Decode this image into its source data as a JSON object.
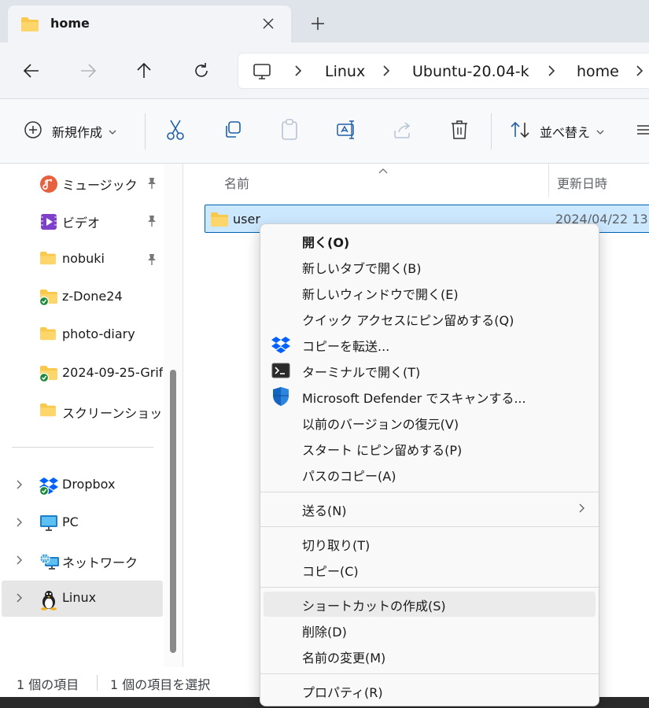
{
  "tab": {
    "title": "home",
    "close": "✕",
    "new": "+"
  },
  "breadcrumb": [
    "Linux",
    "Ubuntu-20.04-k",
    "home"
  ],
  "toolbar": {
    "new_label": "新規作成",
    "sort_label": "並べ替え"
  },
  "sidebar": {
    "quick": [
      {
        "label": "ミュージック",
        "icon": "music-icon",
        "pinned": true
      },
      {
        "label": "ビデオ",
        "icon": "video-icon",
        "pinned": true
      },
      {
        "label": "nobuki",
        "icon": "folder-icon",
        "pinned": true
      },
      {
        "label": "z-Done24",
        "icon": "folder-synced-icon",
        "pinned": false
      },
      {
        "label": "photo-diary",
        "icon": "folder-icon",
        "pinned": false
      },
      {
        "label": "2024-09-25-Grif",
        "icon": "folder-synced-icon",
        "pinned": false
      },
      {
        "label": "スクリーンショット",
        "icon": "folder-icon",
        "pinned": false
      }
    ],
    "locations": [
      {
        "label": "Dropbox",
        "icon": "dropbox-icon"
      },
      {
        "label": "PC",
        "icon": "pc-icon"
      },
      {
        "label": "ネットワーク",
        "icon": "network-icon"
      },
      {
        "label": "Linux",
        "icon": "linux-icon",
        "selected": true
      }
    ]
  },
  "columns": {
    "name": "名前",
    "date": "更新日時"
  },
  "files": [
    {
      "name": "user",
      "date": "2024/04/22 13"
    }
  ],
  "status": {
    "count": "1 個の項目",
    "selected": "1 個の項目を選択"
  },
  "context_menu": {
    "groups": [
      [
        {
          "label": "開く(O)",
          "bold": true,
          "icon": ""
        },
        {
          "label": "新しいタブで開く(B)",
          "icon": ""
        },
        {
          "label": "新しいウィンドウで開く(E)",
          "icon": ""
        },
        {
          "label": "クイック アクセスにピン留めする(Q)",
          "icon": ""
        },
        {
          "label": "コピーを転送...",
          "icon": "dropbox-icon"
        },
        {
          "label": "ターミナルで開く(T)",
          "icon": "terminal-icon"
        },
        {
          "label": "Microsoft Defender でスキャンする...",
          "icon": "defender-shield-icon"
        },
        {
          "label": "以前のバージョンの復元(V)",
          "icon": ""
        },
        {
          "label": "スタート にピン留めする(P)",
          "icon": ""
        },
        {
          "label": "パスのコピー(A)",
          "icon": ""
        }
      ],
      [
        {
          "label": "送る(N)",
          "submenu": true,
          "icon": ""
        }
      ],
      [
        {
          "label": "切り取り(T)",
          "icon": ""
        },
        {
          "label": "コピー(C)",
          "icon": ""
        }
      ],
      [
        {
          "label": "ショートカットの作成(S)",
          "icon": "",
          "hover": true
        },
        {
          "label": "削除(D)",
          "icon": ""
        },
        {
          "label": "名前の変更(M)",
          "icon": ""
        }
      ],
      [
        {
          "label": "プロパティ(R)",
          "icon": ""
        }
      ]
    ]
  },
  "colors": {
    "accent": "#0063b1",
    "selection": "#cce8ff",
    "folder": "#f8c94a"
  }
}
